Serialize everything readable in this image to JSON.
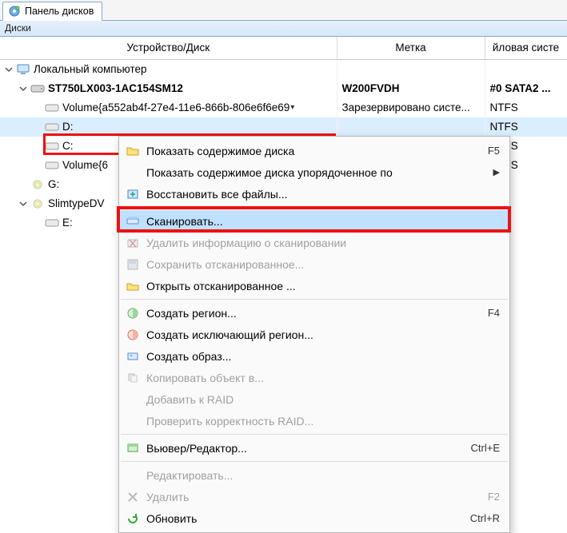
{
  "tab": {
    "title": "Панель дисков"
  },
  "subheader": "Диски",
  "columns": {
    "device": "Устройство/Диск",
    "label": "Метка",
    "fs": "йловая систе"
  },
  "tree": {
    "root": {
      "label": "Локальный компьютер"
    },
    "disk": {
      "label": "ST750LX003-1AC154SM12",
      "col_label": "W200FVDH",
      "col_fs": "#0 SATA2 ..."
    },
    "vol_guid": {
      "label": "Volume{a552ab4f-27e4-11e6-866b-806e6f6e69",
      "col_label": "Зарезервировано систе...",
      "col_fs": "NTFS"
    },
    "d": {
      "label": "D:",
      "col_fs": "NTFS"
    },
    "c": {
      "label": "C:",
      "col_fs": "NTFS"
    },
    "vol2": {
      "label": "Volume{6",
      "col_fs": "NTFS"
    },
    "g": {
      "label": "G:"
    },
    "slim": {
      "label": "SlimtypeDV"
    },
    "e": {
      "label": "E:"
    }
  },
  "ctx": {
    "show_contents": "Показать содержимое диска",
    "show_sorted": "Показать содержимое диска упорядоченное по",
    "recover_all": "Восстановить все файлы...",
    "scan": "Сканировать...",
    "del_scan": "Удалить информацию о сканировании",
    "save_scan": "Сохранить отсканированное...",
    "open_scan": "Открыть отсканированное ...",
    "create_region": "Создать регион...",
    "create_excl_region": "Создать исключающий регион...",
    "create_image": "Создать образ...",
    "copy_obj": "Копировать объект в...",
    "add_raid": "Добавить к RAID",
    "check_raid": "Проверить корректность RAID...",
    "viewer": "Вьювер/Редактор...",
    "edit": "Редактировать...",
    "delete": "Удалить",
    "refresh": "Обновить",
    "sc_f5": "F5",
    "sc_f4": "F4",
    "sc_ctrlE": "Ctrl+E",
    "sc_f2": "F2",
    "sc_ctrlR": "Ctrl+R"
  }
}
